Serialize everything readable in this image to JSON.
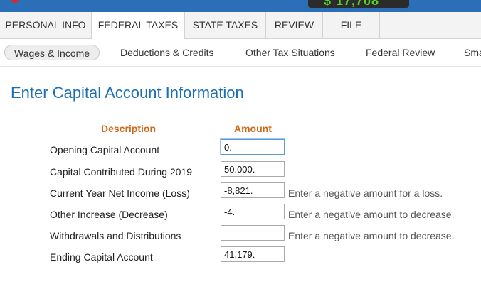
{
  "header": {
    "refund_amount": "$ 17,708"
  },
  "main_tabs": [
    {
      "label": "PERSONAL INFO"
    },
    {
      "label": "FEDERAL TAXES"
    },
    {
      "label": "STATE TAXES"
    },
    {
      "label": "REVIEW"
    },
    {
      "label": "FILE"
    }
  ],
  "active_main_tab": "FEDERAL TAXES",
  "sub_nav": [
    {
      "label": "Wages & Income"
    },
    {
      "label": "Deductions & Credits"
    },
    {
      "label": "Other Tax Situations"
    },
    {
      "label": "Federal Review"
    },
    {
      "label": "Sma"
    }
  ],
  "active_sub_nav": "Wages & Income",
  "page": {
    "title": "Enter Capital Account Information",
    "col_description": "Description",
    "col_amount": "Amount"
  },
  "rows": [
    {
      "label": "Opening Capital Account",
      "value": "0.",
      "hint": ""
    },
    {
      "label": "Capital Contributed During 2019",
      "value": "50,000.",
      "hint": ""
    },
    {
      "label": "Current Year Net Income (Loss)",
      "value": "-8,821.",
      "hint": "Enter a negative amount for a loss."
    },
    {
      "label": "Other Increase (Decrease)",
      "value": "-4.",
      "hint": "Enter a negative amount to decrease."
    },
    {
      "label": "Withdrawals and Distributions",
      "value": "",
      "hint": "Enter a negative amount to decrease."
    },
    {
      "label": "Ending Capital Account",
      "value": "41,179.",
      "hint": ""
    }
  ],
  "colors": {
    "brand_blue": "#2a6fb7",
    "title_blue": "#1c6fb5",
    "header_orange": "#cc6a1c",
    "refund_green": "#55d22b"
  }
}
